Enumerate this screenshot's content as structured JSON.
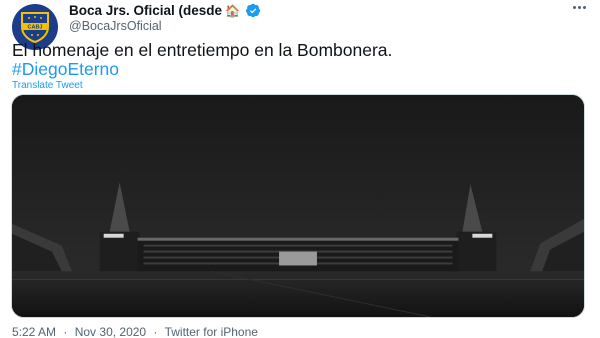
{
  "account": {
    "display_name": "Boca Jrs. Oficial (desde",
    "name_emoji": "🏠",
    "handle": "@BocaJrsOficial",
    "avatar_text": "CABJ",
    "verified": true
  },
  "tweet": {
    "text": "El homenaje en el entretiempo en la Bombonera.",
    "hashtag": "#DiegoEterno",
    "translate_label": "Translate Tweet"
  },
  "meta": {
    "time": "5:22 AM",
    "separator": "·",
    "date": "Nov 30, 2020",
    "source": "Twitter for iPhone"
  },
  "icons": {
    "verified": "verified-badge-icon",
    "more": "more-options-icon",
    "crest": "club-crest-icon"
  },
  "colors": {
    "link": "#1d9bf0",
    "secondary_text": "#536471",
    "club_blue": "#1c3d8a",
    "club_gold": "#f2c100"
  }
}
